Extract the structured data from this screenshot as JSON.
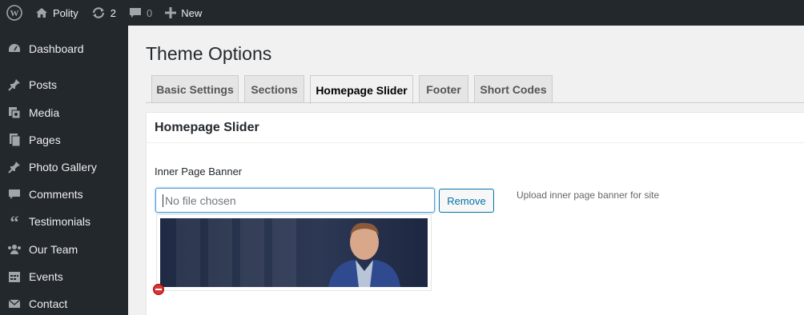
{
  "adminbar": {
    "site_name": "Polity",
    "updates_count": "2",
    "comments_count": "0",
    "new_label": "New"
  },
  "sidebar": {
    "items": [
      {
        "label": "Dashboard",
        "icon": "dashboard-icon"
      },
      {
        "label": "Posts",
        "icon": "pin-icon"
      },
      {
        "label": "Media",
        "icon": "media-icon"
      },
      {
        "label": "Pages",
        "icon": "pages-icon"
      },
      {
        "label": "Photo Gallery",
        "icon": "pin-icon"
      },
      {
        "label": "Comments",
        "icon": "comment-icon"
      },
      {
        "label": "Testimonials",
        "icon": "quote-icon"
      },
      {
        "label": "Our Team",
        "icon": "groups-icon"
      },
      {
        "label": "Events",
        "icon": "calendar-icon"
      },
      {
        "label": "Contact",
        "icon": "email-icon"
      }
    ]
  },
  "page": {
    "title": "Theme Options",
    "tabs": [
      {
        "label": "Basic Settings"
      },
      {
        "label": "Sections"
      },
      {
        "label": "Homepage Slider"
      },
      {
        "label": "Footer"
      },
      {
        "label": "Short Codes"
      }
    ],
    "active_tab": "Homepage Slider"
  },
  "panel": {
    "heading": "Homepage Slider",
    "field_label": "Inner Page Banner",
    "file_value": "No file chosen",
    "remove_label": "Remove",
    "help_text": "Upload inner page banner for site"
  },
  "colors": {
    "adminbar_bg": "#23282d",
    "accent": "#0073aa",
    "focus": "#5b9dd9",
    "remove_red": "#d63638"
  }
}
